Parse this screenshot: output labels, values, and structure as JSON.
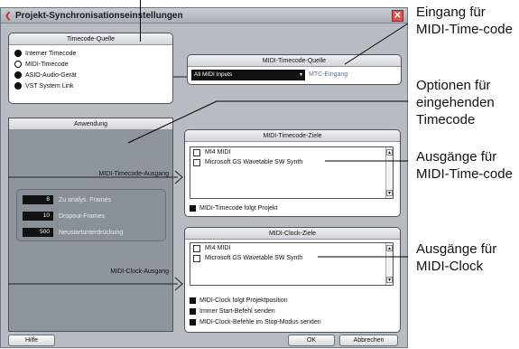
{
  "window": {
    "title": "Projekt-Synchronisationseinstellungen",
    "close_glyph": "✕",
    "app_glyph": "❮"
  },
  "timecode_source": {
    "title": "Timecode-Quelle",
    "options": [
      {
        "label": "Interner Timecode",
        "selected": false
      },
      {
        "label": "MIDI-Timecode",
        "selected": true
      },
      {
        "label": "ASIO-Audio-Gerät",
        "selected": false
      },
      {
        "label": "VST System Link",
        "selected": false
      }
    ]
  },
  "midi_timecode_source": {
    "title": "MIDI-Timecode-Quelle",
    "dropdown_value": "All MIDI Inputs",
    "input_label": "MTC-Eingang"
  },
  "application": {
    "title": "Anwendung",
    "mtc_output_label": "MIDI-Timecode-Ausgang",
    "fields": [
      {
        "value": "8",
        "label": "Zu analys. Frames"
      },
      {
        "value": "10",
        "label": "Dropout-Frames"
      },
      {
        "value": "500",
        "label": "Neustartunterdrückung"
      }
    ],
    "clock_output_label": "MIDI-Clock-Ausgang"
  },
  "mtc_targets": {
    "title": "MIDI-Timecode-Ziele",
    "items": [
      "MI4 MIDI",
      "Microsoft GS Wavetable SW Synth"
    ],
    "follow_label": "MIDI-Timecode folgt Projekt"
  },
  "clock_targets": {
    "title": "MIDI-Clock-Ziele",
    "items": [
      "MI4 MIDI",
      "Microsoft GS Wavetable SW Synth"
    ],
    "options": [
      "MIDI-Clock folgt Projektposition",
      "Immer Start-Befehl senden",
      "MIDI-Clock-Befehle im Stop-Modus senden"
    ]
  },
  "buttons": {
    "help": "Hilfe",
    "ok": "OK",
    "cancel": "Abbrechen"
  },
  "callouts": {
    "input": "Eingang für MIDI-Time-code",
    "options": "Optionen für eingehenden Timecode",
    "mtc_outputs": "Ausgänge für MIDI-Time-code",
    "clock_outputs": "Ausgänge für MIDI-Clock"
  },
  "colors": {
    "window_bg": "#b7bcc3",
    "panel_dark": "#8f959d",
    "close_red": "#d9534f"
  }
}
